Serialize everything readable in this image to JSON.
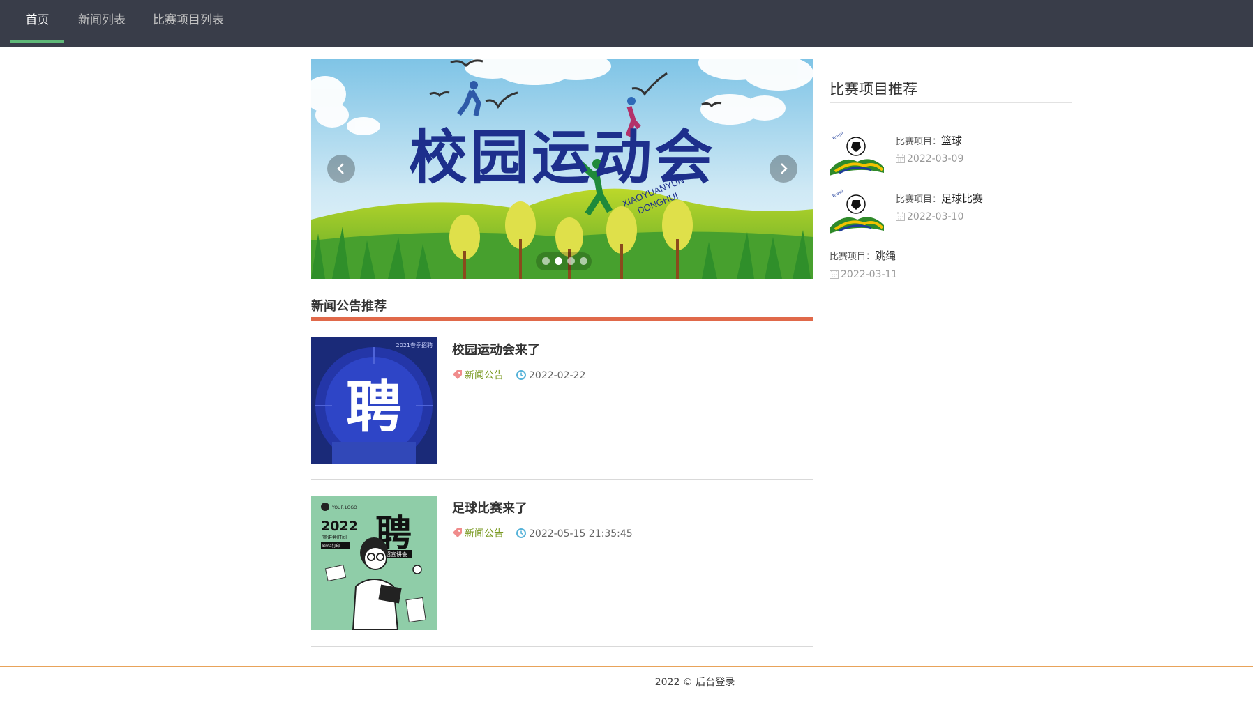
{
  "nav": {
    "items": [
      {
        "label": "首页",
        "active": true
      },
      {
        "label": "新闻列表",
        "active": false
      },
      {
        "label": "比赛项目列表",
        "active": false
      }
    ]
  },
  "banner": {
    "title_art": "校园运动会",
    "subtitle_art": "XIAOYUANYUN DONGHUI",
    "prev_icon": "chevron-left-icon",
    "next_icon": "chevron-right-icon",
    "slide_count": 4,
    "active_slide": 2
  },
  "news": {
    "section_title": "新闻公告推荐",
    "items": [
      {
        "title": "校园运动会来了",
        "category": "新闻公告",
        "date": "2022-02-22",
        "thumb_text": "聘",
        "thumb_caption": "2021春季招聘"
      },
      {
        "title": "足球比赛来了",
        "category": "新闻公告",
        "date": "2022-05-15 21:35:45",
        "thumb_text": "聘",
        "thumb_year": "2022",
        "thumb_sub": "宣讲会时间",
        "thumb_tag": "春招宣讲会",
        "thumb_logo": "YOUR LOGO",
        "thumb_badge": "Bma打印"
      }
    ]
  },
  "sidebar": {
    "title": "比赛项目推荐",
    "label_prefix": "比赛项目：",
    "items": [
      {
        "name": "篮球",
        "date": "2022-03-09",
        "has_thumb": true
      },
      {
        "name": "足球比赛",
        "date": "2022-03-10",
        "has_thumb": true
      },
      {
        "name": "跳绳",
        "date": "2022-03-11",
        "has_thumb": false
      }
    ]
  },
  "footer": {
    "year": "2022 ©",
    "admin_link": "后台登录"
  },
  "colors": {
    "nav_bg": "#393d49",
    "nav_active_bar": "#5fb878",
    "section_line": "#e0694a",
    "category_green": "#7a9a22",
    "footer_line": "#e8a35a"
  }
}
